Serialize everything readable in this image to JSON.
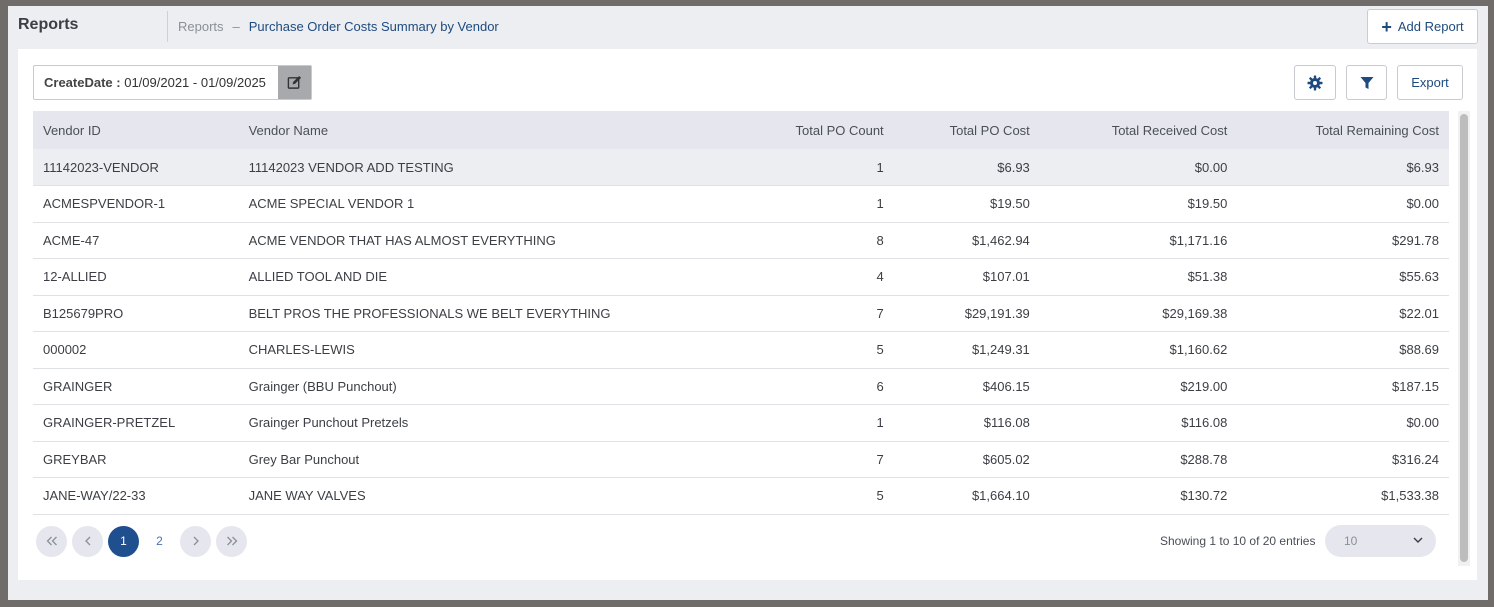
{
  "header": {
    "section_title": "Reports",
    "breadcrumb_root": "Reports",
    "breadcrumb_sep": "–",
    "breadcrumb_current": "Purchase Order Costs Summary by Vendor",
    "add_report_label": "Add Report"
  },
  "filters": {
    "date_label": "CreateDate :",
    "date_value": "01/09/2021 - 01/09/2025"
  },
  "toolbar": {
    "settings_icon": "gear-icon",
    "filter_icon": "funnel-icon",
    "export_label": "Export"
  },
  "table": {
    "columns": [
      "Vendor ID",
      "Vendor Name",
      "Total PO Count",
      "Total PO Cost",
      "Total Received Cost",
      "Total Remaining Cost"
    ],
    "rows": [
      [
        "11142023-VENDOR",
        "11142023 VENDOR ADD TESTING",
        "1",
        "$6.93",
        "$0.00",
        "$6.93"
      ],
      [
        "ACMESPVENDOR-1",
        "ACME SPECIAL VENDOR 1",
        "1",
        "$19.50",
        "$19.50",
        "$0.00"
      ],
      [
        "ACME-47",
        "ACME VENDOR THAT HAS ALMOST EVERYTHING",
        "8",
        "$1,462.94",
        "$1,171.16",
        "$291.78"
      ],
      [
        "12-ALLIED",
        "ALLIED TOOL AND DIE",
        "4",
        "$107.01",
        "$51.38",
        "$55.63"
      ],
      [
        "B125679PRO",
        "BELT PROS THE PROFESSIONALS WE BELT EVERYTHING",
        "7",
        "$29,191.39",
        "$29,169.38",
        "$22.01"
      ],
      [
        "000002",
        "CHARLES-LEWIS",
        "5",
        "$1,249.31",
        "$1,160.62",
        "$88.69"
      ],
      [
        "GRAINGER",
        "Grainger (BBU Punchout)",
        "6",
        "$406.15",
        "$219.00",
        "$187.15"
      ],
      [
        "GRAINGER-PRETZEL",
        "Grainger Punchout Pretzels",
        "1",
        "$116.08",
        "$116.08",
        "$0.00"
      ],
      [
        "GREYBAR",
        "Grey Bar Punchout",
        "7",
        "$605.02",
        "$288.78",
        "$316.24"
      ],
      [
        "JANE-WAY/22-33",
        "JANE WAY VALVES",
        "5",
        "$1,664.10",
        "$130.72",
        "$1,533.38"
      ]
    ]
  },
  "pagination": {
    "pages": [
      "1",
      "2"
    ],
    "current_page": "1",
    "showing_text": "Showing 1 to 10 of 20 entries",
    "page_size": "10"
  }
}
